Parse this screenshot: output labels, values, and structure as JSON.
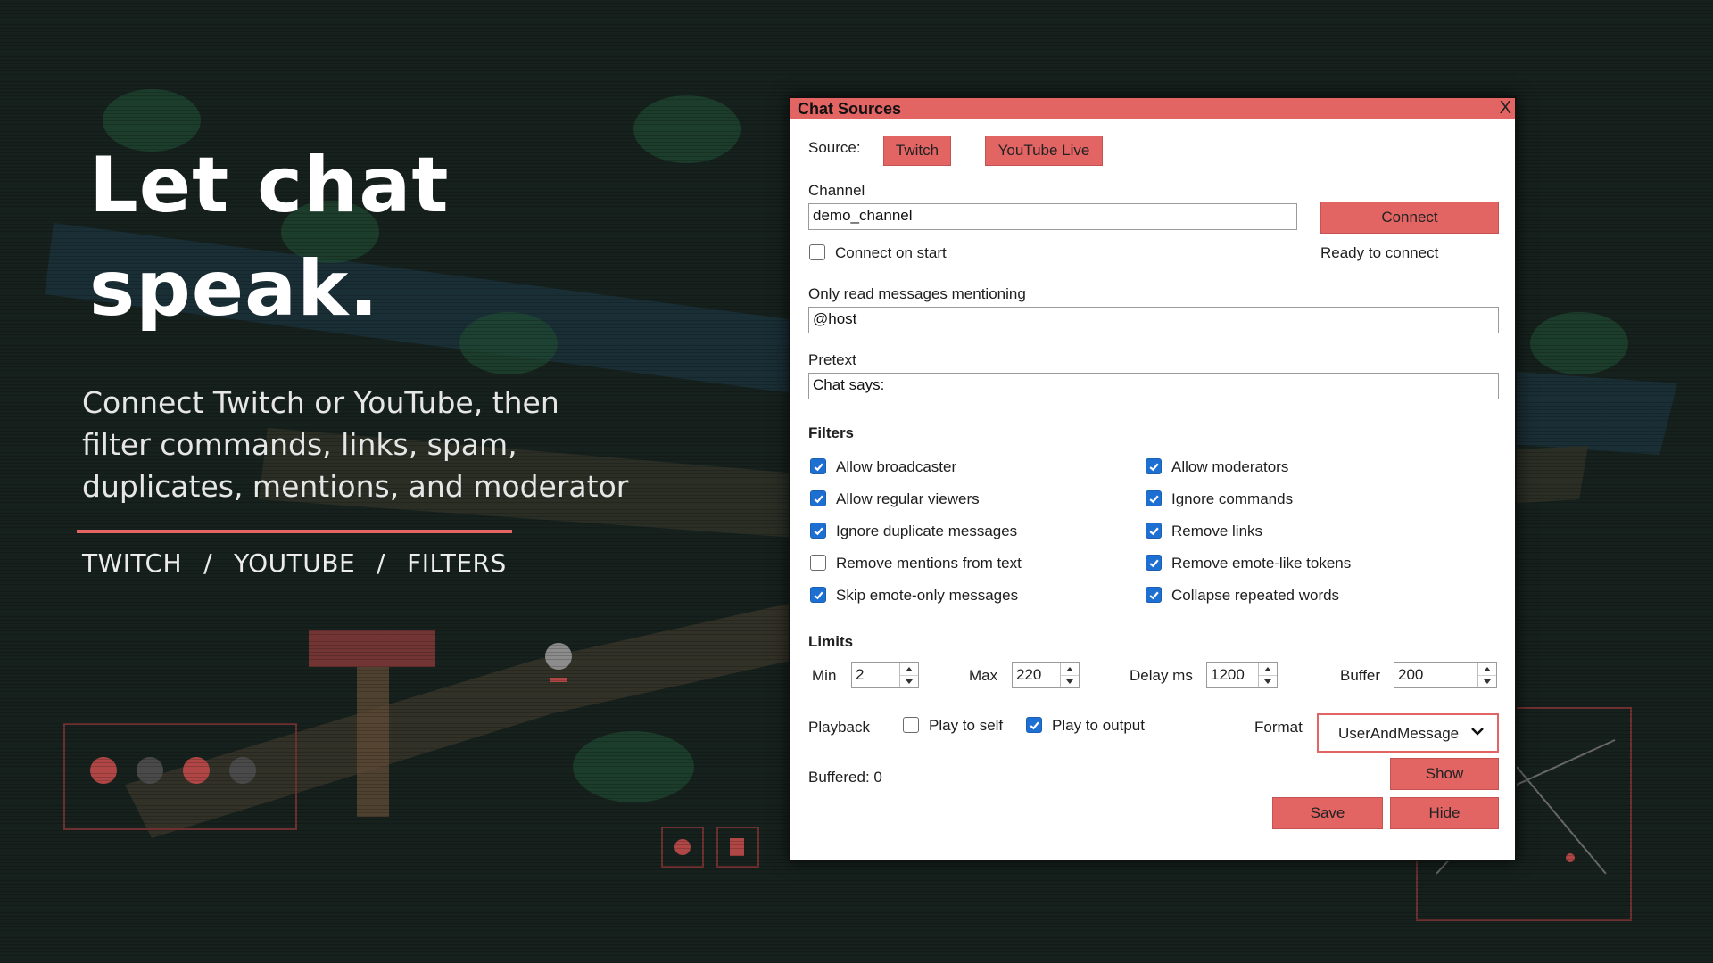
{
  "hero": {
    "title_line1": "Let chat",
    "title_line2": "speak.",
    "subtitle_line1": "Connect Twitch or YouTube, then",
    "subtitle_line2": "filter commands, links, spam,",
    "subtitle_line3": "duplicates, mentions, and moderator",
    "tags": [
      "TWITCH",
      "YOUTUBE",
      "FILTERS"
    ],
    "separator": "/"
  },
  "window": {
    "title": "Chat Sources",
    "close_glyph": "X",
    "source_label": "Source:",
    "source_buttons": [
      "Twitch",
      "YouTube Live"
    ],
    "channel_label": "Channel",
    "channel_value": "demo_channel",
    "connect_label": "Connect",
    "connect_on_start_label": "Connect on start",
    "connect_on_start_checked": false,
    "status_text": "Ready to connect",
    "mention_label": "Only read messages mentioning",
    "mention_value": "@host",
    "pretext_label": "Pretext",
    "pretext_value": "Chat says:",
    "filters_heading": "Filters",
    "filters_left": [
      {
        "label": "Allow broadcaster",
        "checked": true
      },
      {
        "label": "Allow regular viewers",
        "checked": true
      },
      {
        "label": "Ignore duplicate messages",
        "checked": true
      },
      {
        "label": "Remove mentions from text",
        "checked": false
      },
      {
        "label": "Skip emote-only messages",
        "checked": true
      }
    ],
    "filters_right": [
      {
        "label": "Allow moderators",
        "checked": true
      },
      {
        "label": "Ignore commands",
        "checked": true
      },
      {
        "label": "Remove links",
        "checked": true
      },
      {
        "label": "Remove emote-like tokens",
        "checked": true
      },
      {
        "label": "Collapse repeated words",
        "checked": true
      }
    ],
    "limits_heading": "Limits",
    "limits": [
      {
        "label": "Min",
        "value": "2"
      },
      {
        "label": "Max",
        "value": "220"
      },
      {
        "label": "Delay ms",
        "value": "1200"
      },
      {
        "label": "Buffer",
        "value": "200"
      }
    ],
    "playback_label": "Playback",
    "play_to_self_label": "Play to self",
    "play_to_self_checked": false,
    "play_to_output_label": "Play to output",
    "play_to_output_checked": true,
    "format_label": "Format",
    "format_value": "UserAndMessage",
    "buffered_text": "Buffered: 0",
    "show_label": "Show",
    "save_label": "Save",
    "hide_label": "Hide"
  },
  "colors": {
    "accent": "#e26463",
    "checkbox_blue": "#1e6fd2",
    "background": "#16211d"
  }
}
